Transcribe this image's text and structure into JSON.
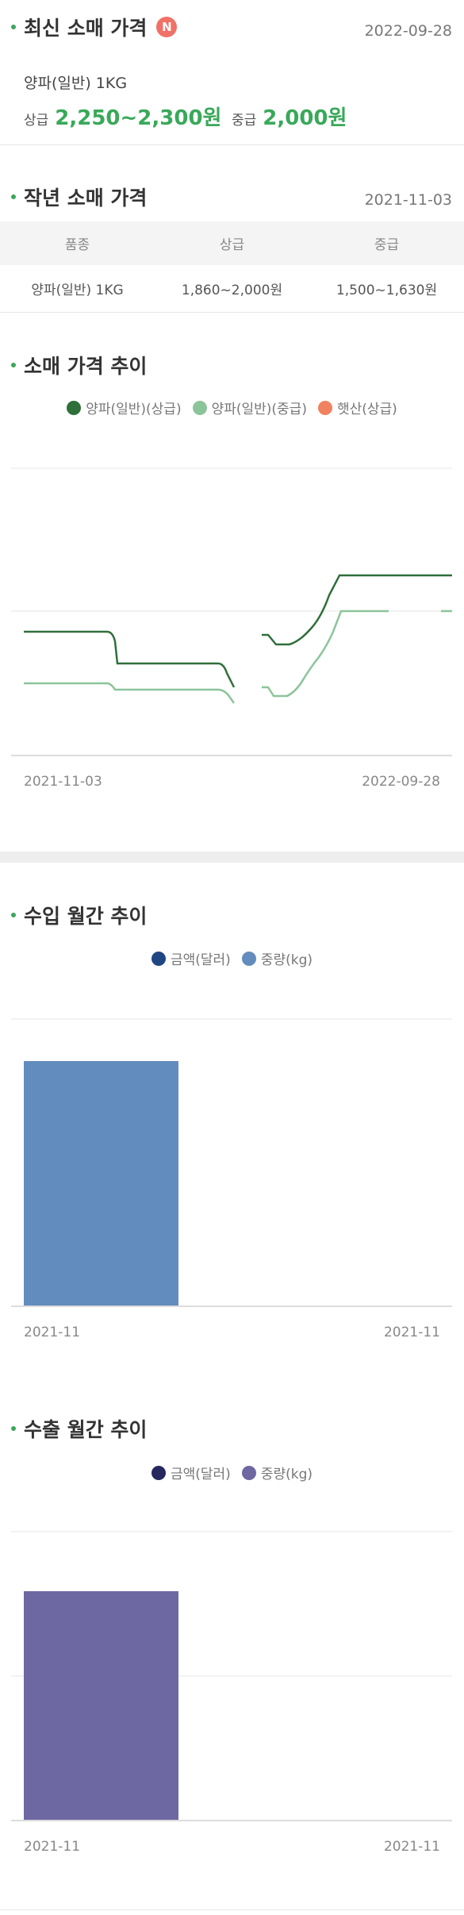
{
  "latest_retail": {
    "title": "최신 소매 가격",
    "badge": "N",
    "date": "2022-09-28",
    "product": "양파(일반) 1KG",
    "grade_high_label": "상급",
    "grade_high_price": "2,250~2,300원",
    "grade_mid_label": "중급",
    "grade_mid_price": "2,000원"
  },
  "last_year_retail": {
    "title": "작년 소매 가격",
    "date": "2021-11-03",
    "headers": [
      "품종",
      "상급",
      "중급"
    ],
    "row": [
      "양파(일반) 1KG",
      "1,860~2,000원",
      "1,500~1,630원"
    ]
  },
  "retail_trend": {
    "title": "소매 가격 추이",
    "legend": [
      {
        "label": "양파(일반)(상급)",
        "color": "#2f6f3a"
      },
      {
        "label": "양파(일반)(중급)",
        "color": "#8cc49a"
      },
      {
        "label": "햇산(상급)",
        "color": "#f0825f"
      }
    ],
    "x_start": "2021-11-03",
    "x_end": "2022-09-28"
  },
  "import_trend": {
    "title": "수입 월간 추이",
    "legend": [
      {
        "label": "금액(달러)",
        "color": "#1f4583"
      },
      {
        "label": "중량(kg)",
        "color": "#628cbd"
      }
    ],
    "x_start": "2021-11",
    "x_end": "2021-11",
    "bar_color": "#628cbd"
  },
  "export_trend": {
    "title": "수출 월간 추이",
    "legend": [
      {
        "label": "금액(달러)",
        "color": "#25275f"
      },
      {
        "label": "중량(kg)",
        "color": "#6d68a2"
      }
    ],
    "x_start": "2021-11",
    "x_end": "2021-11",
    "bar_color": "#6d68a2"
  },
  "chart_data": [
    {
      "type": "line",
      "title": "소매 가격 추이",
      "x": [
        "2021-11-03",
        "2022-09-28"
      ],
      "series": [
        {
          "name": "양파(일반)(상급)",
          "values": [
            2000,
            1700,
            1650,
            2450,
            2450
          ]
        },
        {
          "name": "양파(일반)(중급)",
          "values": [
            1630,
            1600,
            1500,
            2200,
            2200
          ]
        },
        {
          "name": "햇산(상급)",
          "values": []
        }
      ]
    },
    {
      "type": "bar",
      "title": "수입 월간 추이",
      "categories": [
        "2021-11"
      ],
      "series": [
        {
          "name": "중량(kg)",
          "values": [
            1
          ]
        }
      ]
    },
    {
      "type": "bar",
      "title": "수출 월간 추이",
      "categories": [
        "2021-11"
      ],
      "series": [
        {
          "name": "중량(kg)",
          "values": [
            1
          ]
        }
      ]
    }
  ]
}
